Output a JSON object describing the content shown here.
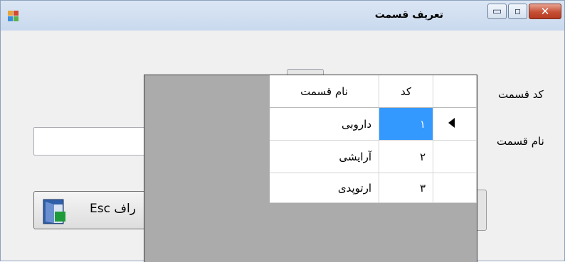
{
  "window": {
    "title": "تعریف قسمت",
    "title_buttons": {
      "close": "✕",
      "maximize": "▫",
      "minimize": "▭"
    }
  },
  "form": {
    "code_label": "کد قسمت",
    "name_label": "نام قسمت",
    "name_value": "",
    "cancel_button": "انصراف Esc",
    "cancel_button_visible": "راف Esc"
  },
  "grid": {
    "columns": [
      "کد",
      "نام قسمت"
    ],
    "rows": [
      {
        "code": "۱",
        "name": "داروبی",
        "selected": true
      },
      {
        "code": "۲",
        "name": "آرایشی",
        "selected": false
      },
      {
        "code": "۳",
        "name": "ارتوپدی",
        "selected": false
      }
    ]
  },
  "colors": {
    "selection": "#3399ff",
    "grid_background": "#ababab",
    "form_background": "#f0f0f0"
  }
}
